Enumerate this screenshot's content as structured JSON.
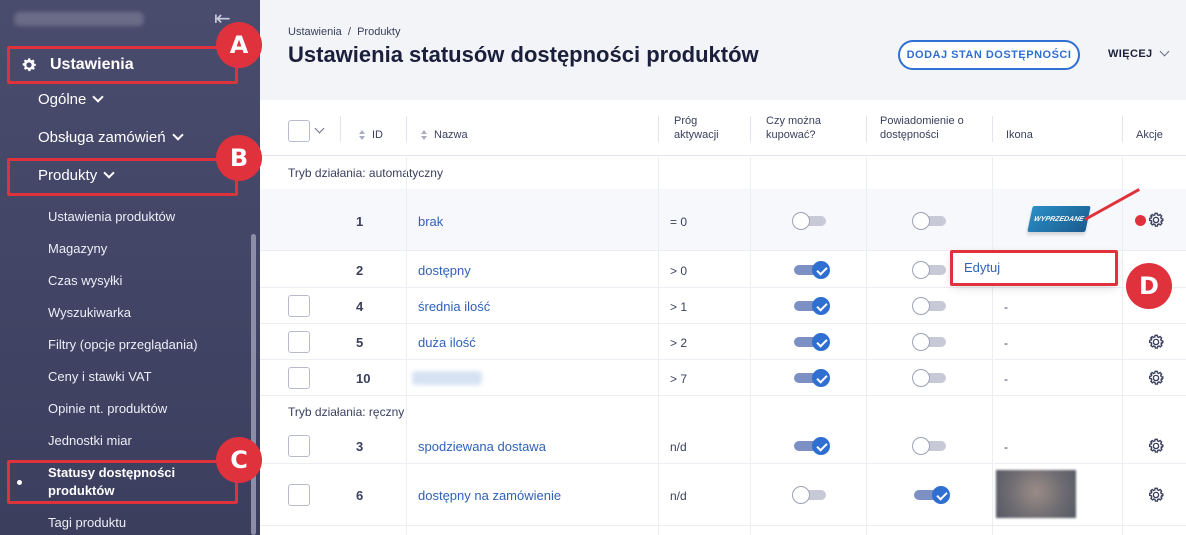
{
  "sidebar": {
    "main_label": "Ustawienia",
    "sub_items": [
      {
        "label": "Ogólne"
      },
      {
        "label": "Obsługa zamówień"
      },
      {
        "label": "Produkty"
      }
    ],
    "leaf_items": [
      {
        "label": "Ustawienia produktów"
      },
      {
        "label": "Magazyny"
      },
      {
        "label": "Czas wysyłki"
      },
      {
        "label": "Wyszukiwarka"
      },
      {
        "label": "Filtry (opcje przeglądania)"
      },
      {
        "label": "Ceny i stawki VAT"
      },
      {
        "label": "Opinie nt. produktów"
      },
      {
        "label": "Jednostki miar"
      },
      {
        "label": "Statusy dostępności produktów"
      },
      {
        "label": "Tagi produktu"
      }
    ]
  },
  "markers": {
    "a": "A",
    "b": "B",
    "c": "C",
    "d": "D"
  },
  "header": {
    "breadcrumb": "Ustawienia  /  Produkty",
    "title": "Ustawienia statusów dostępności produktów",
    "add_button": "DODAJ STAN DOSTĘPNOŚCI",
    "more_button": "WIĘCEJ"
  },
  "table": {
    "columns": {
      "id": "ID",
      "name": "Nazwa",
      "threshold": "Próg aktywacji",
      "can_buy": "Czy można kupować?",
      "notify": "Powiadomienie o dostępności",
      "icon": "Ikona",
      "actions": "Akcje"
    },
    "group_auto": "Tryb działania: automatyczny",
    "group_manual": "Tryb działania: ręczny",
    "rows": [
      {
        "id": "1",
        "name": "brak",
        "threshold": "= 0",
        "can_buy": false,
        "notify": false,
        "icon": "ribbon",
        "icon_text": "WYPRZEDANE"
      },
      {
        "id": "2",
        "name": "dostępny",
        "threshold": "> 0",
        "can_buy": true,
        "notify": false,
        "icon": ""
      },
      {
        "id": "4",
        "name": "średnia ilość",
        "threshold": "> 1",
        "can_buy": true,
        "notify": false,
        "icon": "-"
      },
      {
        "id": "5",
        "name": "duża ilość",
        "threshold": "> 2",
        "can_buy": true,
        "notify": false,
        "icon": "-"
      },
      {
        "id": "10",
        "name": "",
        "threshold": "> 7",
        "can_buy": true,
        "notify": false,
        "icon": "-"
      },
      {
        "id": "3",
        "name": "spodziewana dostawa",
        "threshold": "n/d",
        "can_buy": true,
        "notify": false,
        "icon": "-"
      },
      {
        "id": "6",
        "name": "dostępny na zamówienie",
        "threshold": "n/d",
        "can_buy": false,
        "notify": true,
        "icon": "image"
      }
    ]
  },
  "dropdown": {
    "edit_label": "Edytuj"
  },
  "colors": {
    "accent": "#2f6fd2",
    "highlight": "#e0323c",
    "sidebar": "#4a4c6e"
  }
}
